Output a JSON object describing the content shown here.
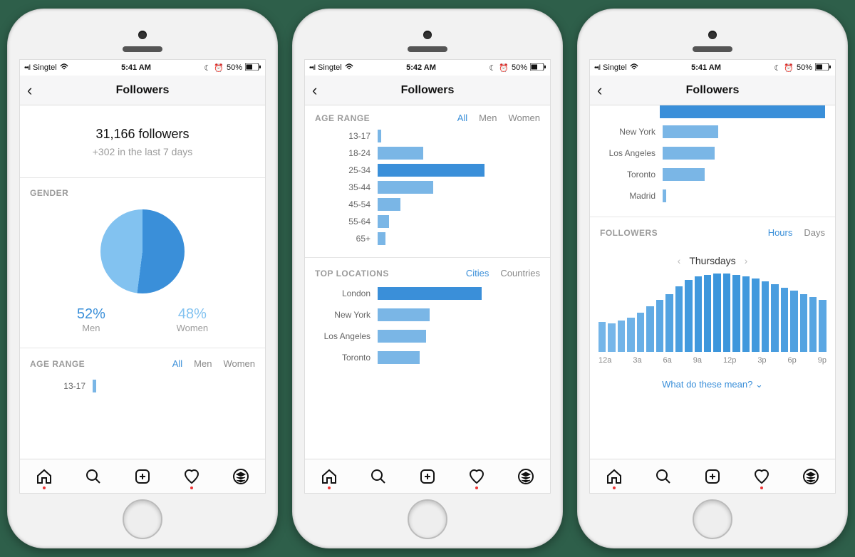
{
  "statusbar": {
    "carrier": "Singtel",
    "battery": "50%"
  },
  "nav": {
    "title": "Followers"
  },
  "screens": [
    {
      "time": "5:41 AM"
    },
    {
      "time": "5:42 AM"
    },
    {
      "time": "5:41 AM"
    }
  ],
  "summary": {
    "count": "31,166 followers",
    "delta": "+302 in the last 7 days"
  },
  "gender": {
    "label": "GENDER",
    "men_pct": "52%",
    "men_label": "Men",
    "women_pct": "48%",
    "women_label": "Women"
  },
  "age": {
    "label": "AGE RANGE",
    "tabs": {
      "all": "All",
      "men": "Men",
      "women": "Women"
    },
    "preview_cat": "13-17"
  },
  "locations": {
    "label": "TOP LOCATIONS",
    "tabs": {
      "cities": "Cities",
      "countries": "Countries"
    }
  },
  "screen3": {
    "loc_rows": [
      "New York",
      "Los Angeles",
      "Toronto",
      "Madrid"
    ],
    "followers_label": "FOLLOWERS",
    "tabs": {
      "hours": "Hours",
      "days": "Days"
    },
    "day": "Thursdays",
    "xlabels": [
      "12a",
      "3a",
      "6a",
      "9a",
      "12p",
      "3p",
      "6p",
      "9p"
    ],
    "meanlink": "What do these mean?"
  },
  "chart_data": [
    {
      "type": "pie",
      "title": "Gender",
      "series": [
        {
          "name": "Men",
          "value": 52,
          "color": "#3a8fd9"
        },
        {
          "name": "Women",
          "value": 48,
          "color": "#82c2f0"
        }
      ]
    },
    {
      "type": "bar",
      "orientation": "horizontal",
      "title": "Age Range",
      "categories": [
        "13-17",
        "18-24",
        "25-34",
        "35-44",
        "45-54",
        "55-64",
        "65+"
      ],
      "values": [
        2,
        28,
        66,
        34,
        14,
        7,
        5
      ],
      "highlight_index": 2,
      "xlim": [
        0,
        100
      ]
    },
    {
      "type": "bar",
      "orientation": "horizontal",
      "title": "Top Locations (Cities)",
      "categories": [
        "London",
        "New York",
        "Los Angeles",
        "Toronto"
      ],
      "values": [
        64,
        32,
        30,
        26
      ],
      "highlight_index": 0,
      "xlim": [
        0,
        100
      ]
    },
    {
      "type": "bar",
      "orientation": "horizontal",
      "title": "Top Locations cont.",
      "categories": [
        "New York",
        "Los Angeles",
        "Toronto",
        "Madrid"
      ],
      "values": [
        34,
        32,
        26,
        2
      ],
      "xlim": [
        0,
        100
      ]
    },
    {
      "type": "bar",
      "title": "Followers by Hour (Thursdays)",
      "categories": [
        "12a",
        "1a",
        "2a",
        "3a",
        "4a",
        "5a",
        "6a",
        "7a",
        "8a",
        "9a",
        "10a",
        "11a",
        "12p",
        "1p",
        "2p",
        "3p",
        "4p",
        "5p",
        "6p",
        "7p",
        "8p",
        "9p",
        "10p",
        "11p"
      ],
      "values": [
        38,
        36,
        40,
        44,
        50,
        58,
        66,
        74,
        84,
        92,
        96,
        98,
        100,
        100,
        98,
        96,
        94,
        90,
        86,
        82,
        78,
        74,
        70,
        66
      ],
      "ylim": [
        0,
        100
      ]
    }
  ]
}
